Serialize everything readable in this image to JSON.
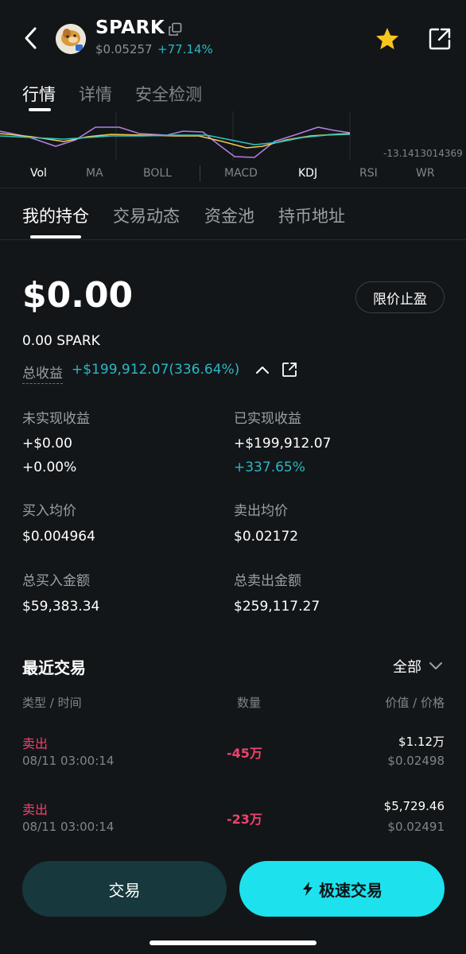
{
  "header": {
    "token_name": "SPARK",
    "price": "$0.05257",
    "change": "+77.14%",
    "icons": [
      "back-icon",
      "token-logo",
      "copy-icon",
      "star-icon",
      "share-icon"
    ]
  },
  "main_tabs": [
    "行情",
    "详情",
    "安全检测"
  ],
  "chart": {
    "readout": "-13.1413014369",
    "indicators": [
      "Vol",
      "MA",
      "BOLL",
      "MACD",
      "KDJ",
      "RSI",
      "WR"
    ],
    "active_indicators": [
      "Vol",
      "KDJ"
    ],
    "line_colors": [
      "#b07fe0",
      "#f2c94c",
      "#2bc5c5"
    ]
  },
  "section_tabs": [
    "我的持仓",
    "交易动态",
    "资金池",
    "持币地址"
  ],
  "holdings": {
    "balance": "$0.00",
    "limit_button": "限价止盈",
    "quantity": "0.00 SPARK",
    "total_pnl_label": "总收益",
    "total_pnl_value": "+$199,912.07(336.64%)",
    "stats": [
      {
        "label": "未实现收益",
        "value": "+$0.00",
        "sub": "+0.00%"
      },
      {
        "label": "已实现收益",
        "value": "+$199,912.07",
        "sub": "+337.65%"
      },
      {
        "label": "买入均价",
        "value": "$0.004964"
      },
      {
        "label": "卖出均价",
        "value": "$0.02172"
      },
      {
        "label": "总买入金额",
        "value": "$59,383.34"
      },
      {
        "label": "总卖出金额",
        "value": "$259,117.27"
      }
    ]
  },
  "recent_trades": {
    "title": "最近交易",
    "filter": "全部",
    "columns": [
      "类型 / 时间",
      "数量",
      "价值 / 价格"
    ],
    "rows": [
      {
        "side": "卖出",
        "time": "08/11 03:00:14",
        "qty": "-45万",
        "value": "$1.12万",
        "price": "$0.02498"
      },
      {
        "side": "卖出",
        "time": "08/11 03:00:14",
        "qty": "-23万",
        "value": "$5,729.46",
        "price": "$0.02491"
      }
    ]
  },
  "bottom": {
    "trade_label": "交易",
    "fast_trade_label": "极速交易"
  },
  "colors": {
    "background": "#131618",
    "accent_teal": "#2bb7c5",
    "sell_red": "#f0426e",
    "fast_button": "#1de2ee",
    "trade_button": "#17383d",
    "star": "#f7c51e"
  }
}
